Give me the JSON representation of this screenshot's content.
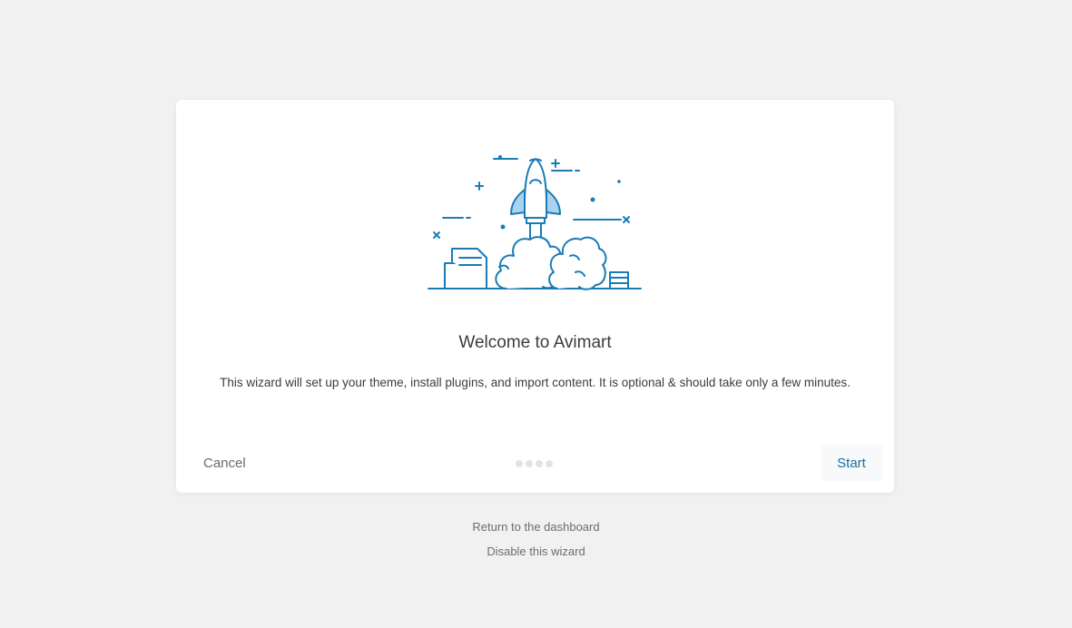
{
  "wizard": {
    "title": "Welcome to Avimart",
    "description": "This wizard will set up your theme, install plugins, and import content. It is optional & should take only a few minutes.",
    "illustration_icon": "rocket-launch-illustration",
    "accent_color": "#1b7bb5",
    "cancel_label": "Cancel",
    "start_label": "Start",
    "steps": {
      "total": 4,
      "current": 1
    }
  },
  "footer": {
    "return_label": "Return to the dashboard",
    "disable_label": "Disable this wizard"
  }
}
